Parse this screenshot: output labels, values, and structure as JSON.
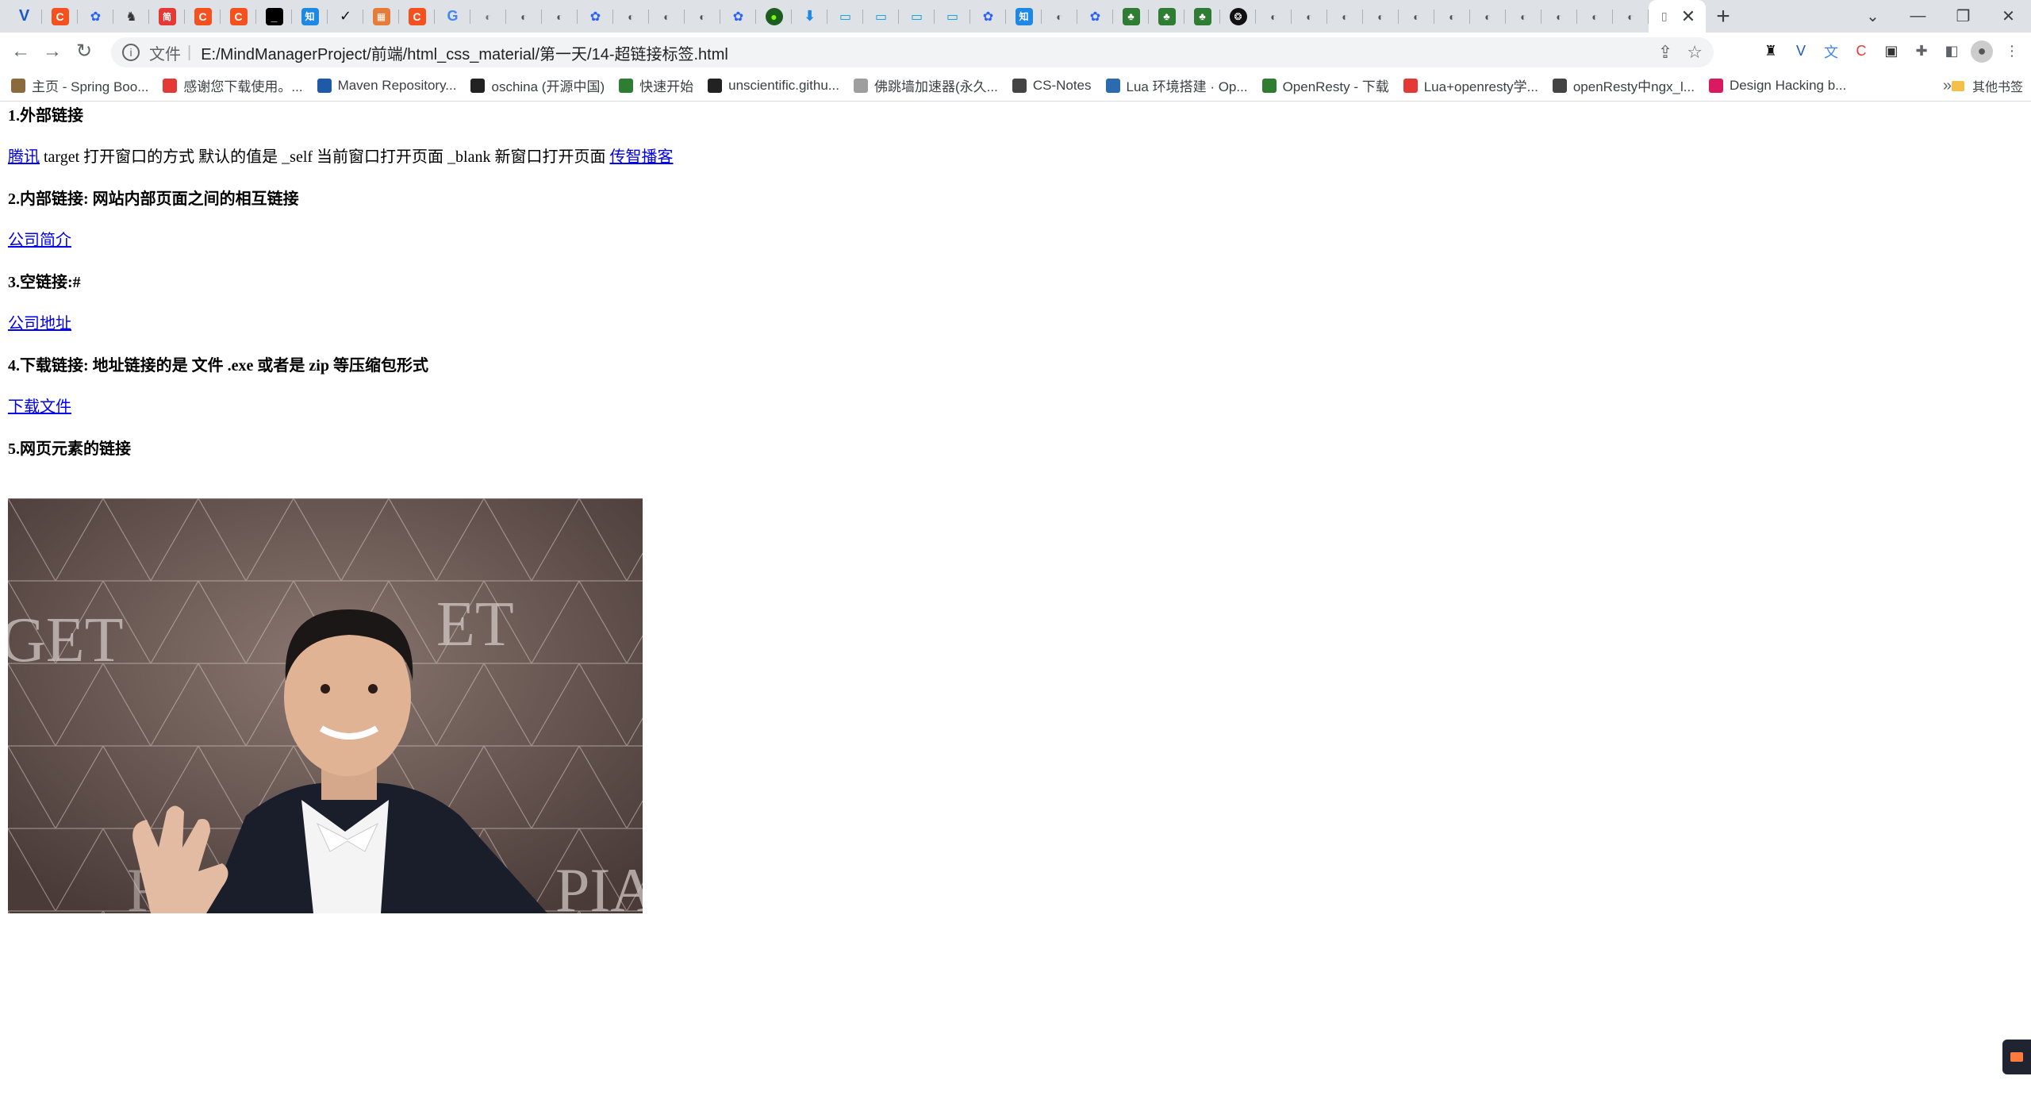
{
  "browser": {
    "active_tab_close": "✕",
    "new_tab": "+",
    "tab_menu": "⌄",
    "window_min": "—",
    "window_restore": "❐",
    "window_close": "✕",
    "nav_back": "←",
    "nav_forward": "→",
    "nav_reload": "↻",
    "url_label": "文件",
    "url": "E:/MindManagerProject/前端/html_css_material/第一天/14-超链接标签.html"
  },
  "bookmarks": [
    {
      "label": "主页 - Spring Boo...",
      "color": "#8b6b3e"
    },
    {
      "label": "感谢您下载使用。...",
      "color": "#e53935"
    },
    {
      "label": "Maven Repository...",
      "color": "#1e5aa8"
    },
    {
      "label": "oschina (开源中国)",
      "color": "#222222"
    },
    {
      "label": "快速开始",
      "color": "#2e7d32"
    },
    {
      "label": "unscientific.githu...",
      "color": "#222222"
    },
    {
      "label": "佛跳墙加速器(永久...",
      "color": "#9e9e9e"
    },
    {
      "label": "CS-Notes",
      "color": "#444444"
    },
    {
      "label": "Lua 环境搭建 · Op...",
      "color": "#2b6cb0"
    },
    {
      "label": "OpenResty - 下载",
      "color": "#2e7d32"
    },
    {
      "label": "Lua+openresty学...",
      "color": "#e53935"
    },
    {
      "label": "openResty中ngx_l...",
      "color": "#444444"
    },
    {
      "label": "Design Hacking b...",
      "color": "#d81b60"
    }
  ],
  "bookmarks_more": "»",
  "bookmarks_other": "其他书签",
  "page": {
    "h1": "1.外部链接",
    "link_tencent": "腾讯",
    "target_desc": " target 打开窗口的方式 默认的值是 _self 当前窗口打开页面 _blank 新窗口打开页面 ",
    "link_itcast": "传智播客",
    "h2": "2.内部链接: 网站内部页面之间的相互链接",
    "link_company_intro": "公司简介",
    "h3": "3.空链接:#",
    "link_company_address": "公司地址",
    "h4": "4.下载链接: 地址链接的是 文件 .exe 或者是 zip 等压缩包形式",
    "link_download": "下载文件",
    "h5": "5.网页元素的链接"
  }
}
